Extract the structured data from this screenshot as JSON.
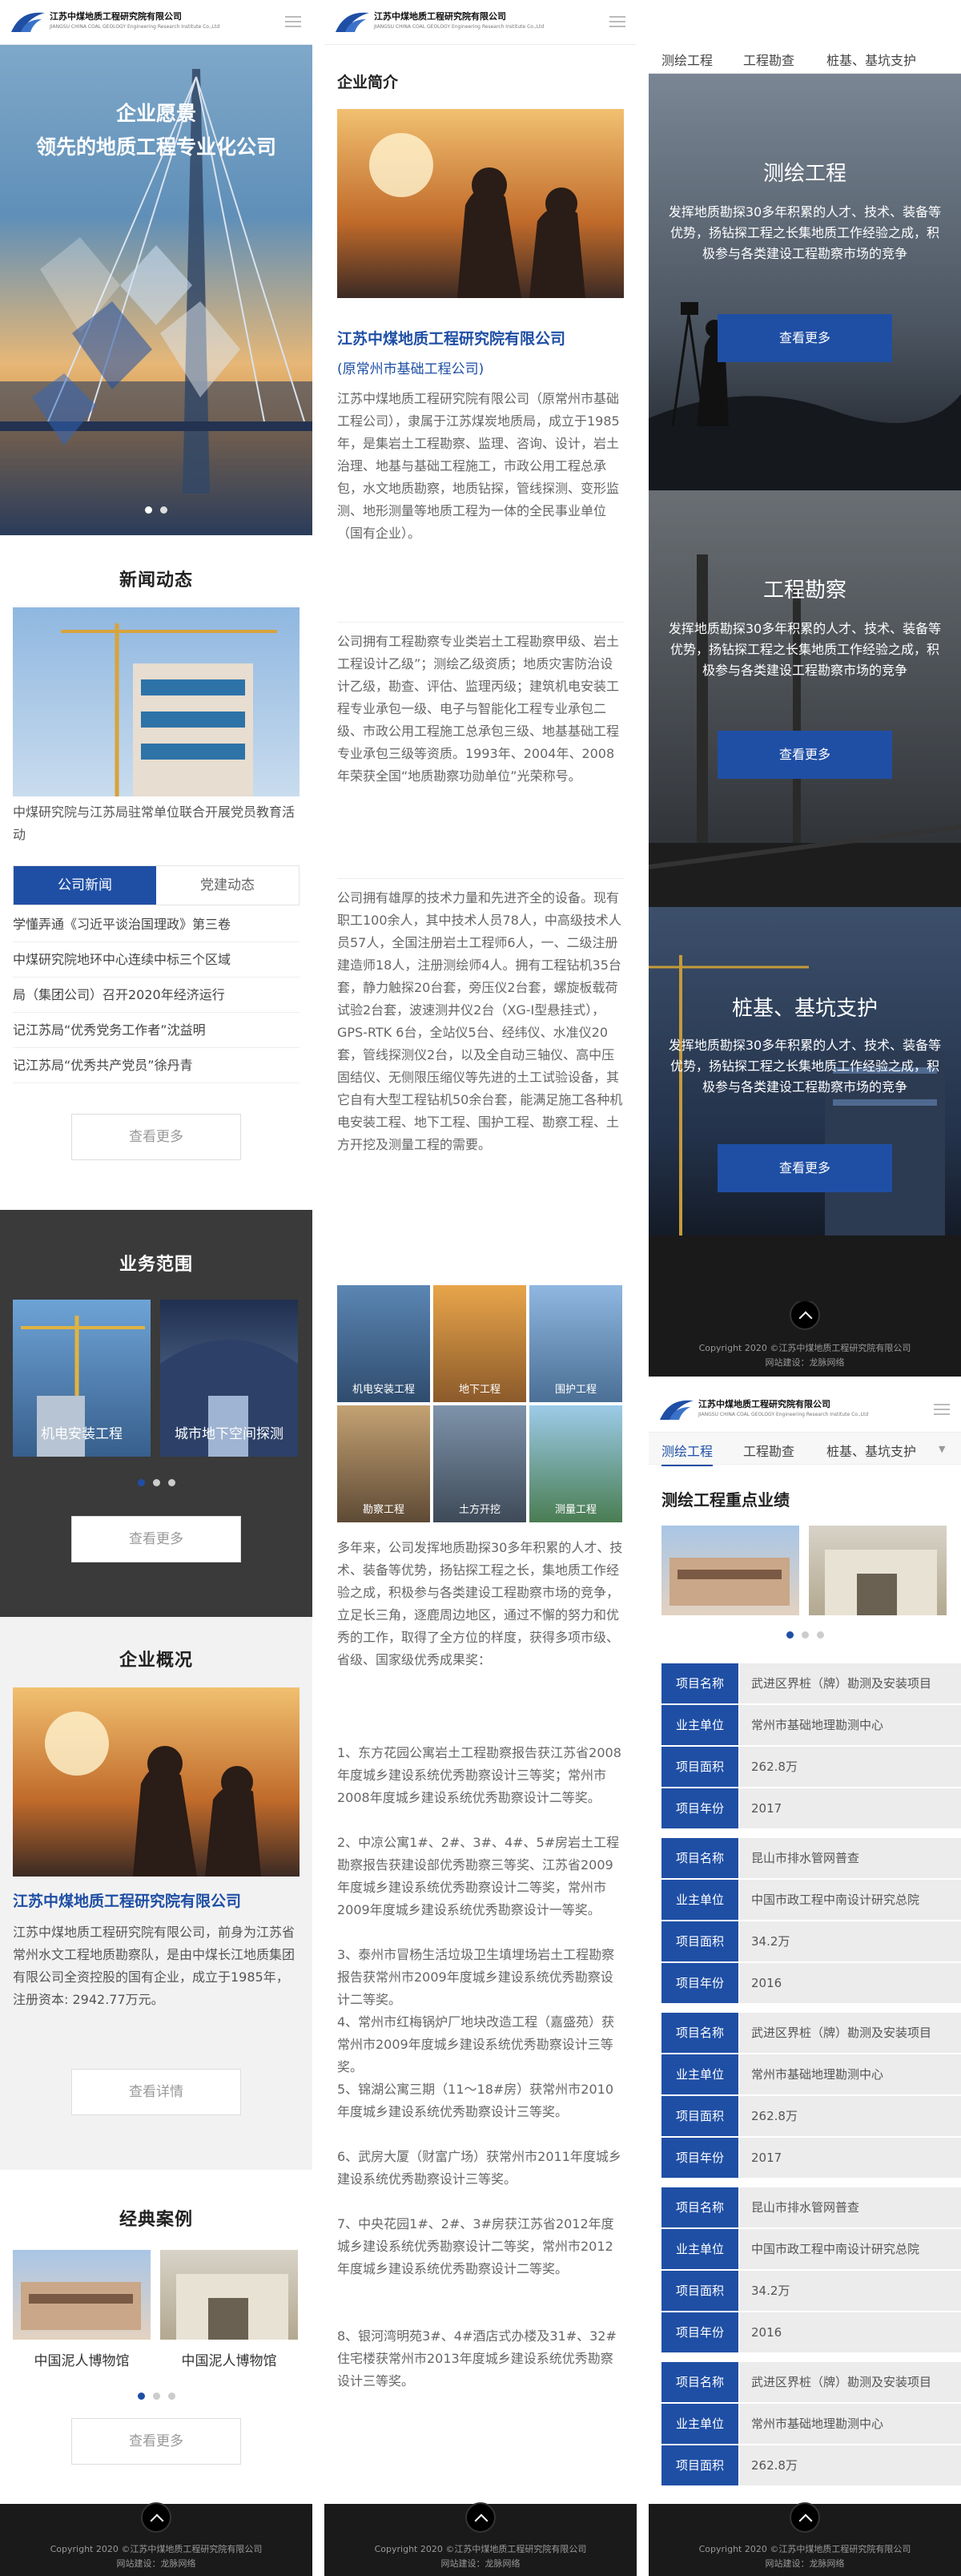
{
  "site": {
    "company": "江苏中煤地质工程研究院有限公司",
    "company_en": "JIANGSU CHINA COAL GEOLOGY Engineering Research Institute Co.,Ltd",
    "copyright": "Copyright 2020 ©江苏中煤地质工程研究院有限公司",
    "builder": "网站建设：龙脉网络"
  },
  "col1": {
    "banner": {
      "line1": "企业愿景",
      "line2": "领先的地质工程专业化公司"
    },
    "news": {
      "title": "新闻动态",
      "caption": "中煤研究院与江苏局驻常单位联合开展党员教育活动",
      "tabs": [
        "公司新闻",
        "党建动态"
      ],
      "items": [
        "学懂弄通《习近平谈治国理政》第三卷",
        "中煤研究院地环中心连续中标三个区域",
        "局（集团公司）召开2020年经济运行",
        "记江苏局“优秀党务工作者”沈益明",
        "记江苏局“优秀共产党员”徐丹青"
      ],
      "more": "查看更多"
    },
    "business": {
      "title": "业务范围",
      "items": [
        "机电安装工程",
        "城市地下空间探测"
      ],
      "more": "查看更多"
    },
    "overview": {
      "title": "企业概况",
      "name": "江苏中煤地质工程研究院有限公司",
      "text": "江苏中煤地质工程研究院有限公司，前身为江苏省常州水文工程地质勘察队，是由中煤长江地质集团有限公司全资控股的国有企业，成立于1985年，注册资本: 2942.77万元。",
      "more": "查看详情"
    },
    "cases": {
      "title": "经典案例",
      "items": [
        "中国泥人博物馆",
        "中国泥人博物馆"
      ],
      "more": "查看更多"
    }
  },
  "col2": {
    "title": "企业简介",
    "name": "江苏中煤地质工程研究院有限公司",
    "name_sub": "(原常州市基础工程公司)",
    "paras": [
      "江苏中煤地质工程研究院有限公司（原常州市基础工程公司），隶属于江苏煤炭地质局，成立于1985年，是集岩土工程勘察、监理、咨询、设计，岩土治理、地基与基础工程施工，市政公用工程总承包，水文地质勘察，地质钻探，管线探测、变形监测、地形测量等地质工程为一体的全民事业单位（国有企业）。",
      "公司拥有工程勘察专业类岩土工程勘察甲级、岩土工程设计乙级”；测绘乙级资质；地质灾害防治设计乙级，勘查、评估、监理丙级；建筑机电安装工程专业承包一级、电子与智能化工程专业承包二级、市政公用工程施工总承包三级、地基基础工程专业承包三级等资质。1993年、2004年、2008年荣获全国“地质勘察功勋单位”光荣称号。",
      "公司拥有雄厚的技术力量和先进齐全的设备。现有职工100余人，其中技术人员78人，中高级技术人员57人，全国注册岩土工程师6人，一、二级注册建造师18人，注册测绘师4人。拥有工程钻机35台套，静力触探20台套，旁压仪2台套，螺旋板载荷试验2台套，波速测井仪2台（XG-Ⅰ型悬挂式），GPS-RTK 6台，全站仪5台、经纬仪、水准仪20套，管线探测仪2台，以及全自动三轴仪、高中压固结仪、无侧限压缩仪等先进的土工试验设备，其它自有大型工程钻机50余台套，能满足施工各种机电安装工程、地下工程、围护工程、勘察工程、土方开挖及测量工程的需要。"
    ],
    "grid": [
      "机电安装工程",
      "地下工程",
      "围护工程",
      "勘察工程",
      "土方开挖",
      "测量工程"
    ],
    "para4": "多年来，公司发挥地质勘探30多年积累的人才、技术、装备等优势，扬钻探工程之长，集地质工作经验之成，积极参与各类建设工程勘察市场的竞争，立足长三角，逐鹿周边地区，通过不懈的努力和优秀的工作，取得了全方位的样度，获得多项市级、省级、国家级优秀成果奖：",
    "awards": [
      "1、东方花园公寓岩土工程勘察报告获江苏省2008年度城乡建设系统优秀勘察设计三等奖；常州市2008年度城乡建设系统优秀勘察设计二等奖。",
      "2、中凉公寓1#、2#、3#、4#、5#房岩土工程勘察报告获建设部优秀勘察三等奖、江苏省2009年度城乡建设系统优秀勘察设计二等奖，常州市2009年度城乡建设系统优秀勘察设计一等奖。",
      "3、泰州市冒杨生活垃圾卫生填埋场岩土工程勘察报告获常州市2009年度城乡建设系统优秀勘察设计二等奖。",
      "4、常州市红梅锅炉厂地块改造工程（嘉盛苑）获常州市2009年度城乡建设系统优秀勘察设计三等奖。",
      "5、锦湖公寓三期（11～18#房）获常州市2010年度城乡建设系统优秀勘察设计三等奖。",
      "6、武房大厦（财富广场）获常州市2011年度城乡建设系统优秀勘察设计三等奖。",
      "7、中央花园1#、2#、3#房获江苏省2012年度城乡建设系统优秀勘察设计二等奖，常州市2012年度城乡建设系统优秀勘察设计二等奖。",
      "8、银河湾明苑3#、4#酒店式办楼及31#、32#住宅楼获常州市2013年度城乡建设系统优秀勘察设计三等奖。"
    ]
  },
  "col3": {
    "nav": [
      "测绘工程",
      "工程勘查",
      "桩基、基坑支护"
    ],
    "cards": [
      {
        "title": "测绘工程",
        "desc": "发挥地质勘探30多年积累的人才、技术、装备等优势，扬钻探工程之长集地质工作经验之成，积极参与各类建设工程勘察市场的竞争",
        "more": "查看更多"
      },
      {
        "title": "工程勘察",
        "desc": "发挥地质勘探30多年积累的人才、技术、装备等优势，扬钻探工程之长集地质工作经验之成，积极参与各类建设工程勘察市场的竞争",
        "more": "查看更多"
      },
      {
        "title": "桩基、基坑支护",
        "desc": "发挥地质勘探30多年积累的人才、技术、装备等优势，扬钻探工程之长集地质工作经验之成，积极参与各类建设工程勘察市场的竞争",
        "more": "查看更多"
      }
    ],
    "detail_title": "测绘工程重点业绩",
    "labels": {
      "name": "项目名称",
      "owner": "业主单位",
      "area": "项目面积",
      "year": "项目年份"
    },
    "projects": [
      {
        "name": "武进区界桩（牌）勘测及安装项目",
        "owner": "常州市基础地理勘测中心",
        "area": "262.8万",
        "year": "2017"
      },
      {
        "name": "昆山市排水管网普查",
        "owner": "中国市政工程中南设计研究总院",
        "area": "34.2万",
        "year": "2016"
      },
      {
        "name": "武进区界桩（牌）勘测及安装项目",
        "owner": "常州市基础地理勘测中心",
        "area": "262.8万",
        "year": "2017"
      },
      {
        "name": "昆山市排水管网普查",
        "owner": "中国市政工程中南设计研究总院",
        "area": "34.2万",
        "year": "2016"
      },
      {
        "name": "武进区界桩（牌）勘测及安装项目",
        "owner": "常州市基础地理勘测中心",
        "area": "262.8万"
      }
    ]
  }
}
